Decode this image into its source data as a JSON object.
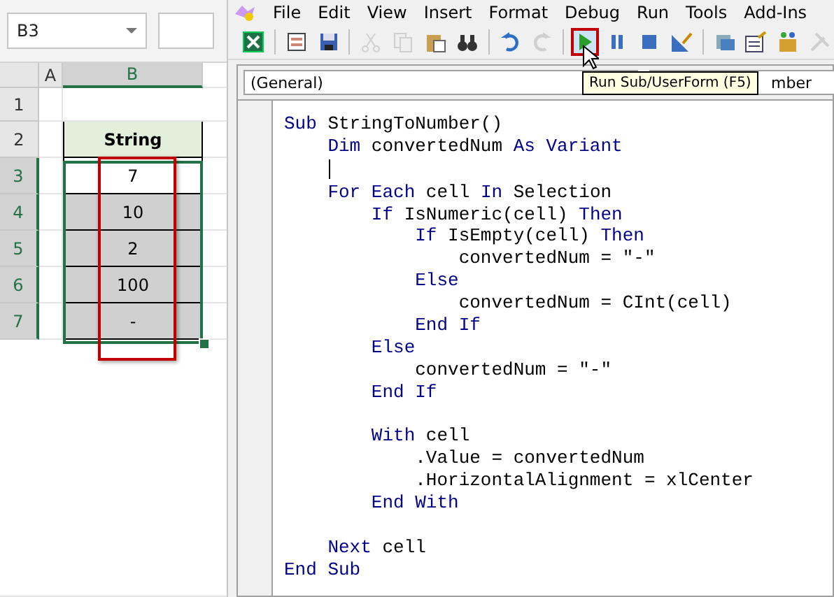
{
  "excel": {
    "name_box": "B3",
    "columns": [
      {
        "label": "A",
        "selected": false
      },
      {
        "label": "B",
        "selected": true
      }
    ],
    "rows": [
      {
        "number": "1",
        "kind": "empty",
        "selected": false
      },
      {
        "number": "2",
        "value": "String",
        "kind": "header",
        "selected": false
      },
      {
        "number": "3",
        "value": "7",
        "kind": "value",
        "selected": true,
        "active": true
      },
      {
        "number": "4",
        "value": "10",
        "kind": "value",
        "selected": true,
        "active": false
      },
      {
        "number": "5",
        "value": "2",
        "kind": "value",
        "selected": true,
        "active": false
      },
      {
        "number": "6",
        "value": "100",
        "kind": "value",
        "selected": true,
        "active": false
      },
      {
        "number": "7",
        "value": "-",
        "kind": "value",
        "selected": true,
        "active": false
      }
    ]
  },
  "vbe": {
    "menu": [
      "File",
      "Edit",
      "View",
      "Insert",
      "Format",
      "Debug",
      "Run",
      "Tools",
      "Add-Ins"
    ],
    "toolbar": [
      {
        "kind": "excel",
        "disabled": false,
        "selected": false
      },
      {
        "kind": "sep"
      },
      {
        "kind": "insert",
        "disabled": false,
        "selected": false
      },
      {
        "kind": "save",
        "disabled": false,
        "selected": false
      },
      {
        "kind": "sep"
      },
      {
        "kind": "cut",
        "disabled": true,
        "selected": false
      },
      {
        "kind": "copy",
        "disabled": true,
        "selected": false
      },
      {
        "kind": "paste",
        "disabled": false,
        "selected": false
      },
      {
        "kind": "find",
        "disabled": false,
        "selected": false
      },
      {
        "kind": "sep"
      },
      {
        "kind": "undo",
        "disabled": false,
        "selected": false
      },
      {
        "kind": "redo",
        "disabled": true,
        "selected": false
      },
      {
        "kind": "sep"
      },
      {
        "kind": "run",
        "disabled": false,
        "selected": true
      },
      {
        "kind": "pause",
        "disabled": false,
        "selected": false
      },
      {
        "kind": "stop",
        "disabled": false,
        "selected": false
      },
      {
        "kind": "design",
        "disabled": false,
        "selected": false
      },
      {
        "kind": "sep"
      },
      {
        "kind": "project",
        "disabled": false,
        "selected": false
      },
      {
        "kind": "properties",
        "disabled": false,
        "selected": false
      },
      {
        "kind": "objects",
        "disabled": false,
        "selected": false
      },
      {
        "kind": "tools",
        "disabled": true,
        "selected": false
      }
    ],
    "object_box": "(General)",
    "procedure_box": "mber",
    "tooltip": "Run Sub/UserForm (F5)",
    "code": [
      {
        "kind": "code",
        "tokens": [
          {
            "text": "Sub",
            "kind": "keyword"
          },
          {
            "text": " StringToNumber()",
            "kind": "plain"
          }
        ]
      },
      {
        "kind": "code",
        "tokens": [
          {
            "text": "    Dim",
            "kind": "keyword"
          },
          {
            "text": " convertedNum ",
            "kind": "plain"
          },
          {
            "text": "As Variant",
            "kind": "keyword"
          }
        ]
      },
      {
        "kind": "cursor"
      },
      {
        "kind": "code",
        "tokens": [
          {
            "text": "    For Each",
            "kind": "keyword"
          },
          {
            "text": " cell ",
            "kind": "plain"
          },
          {
            "text": "In",
            "kind": "keyword"
          },
          {
            "text": " Selection",
            "kind": "plain"
          }
        ]
      },
      {
        "kind": "code",
        "tokens": [
          {
            "text": "        If",
            "kind": "keyword"
          },
          {
            "text": " IsNumeric(cell) ",
            "kind": "plain"
          },
          {
            "text": "Then",
            "kind": "keyword"
          }
        ]
      },
      {
        "kind": "code",
        "tokens": [
          {
            "text": "            If",
            "kind": "keyword"
          },
          {
            "text": " IsEmpty(cell) ",
            "kind": "plain"
          },
          {
            "text": "Then",
            "kind": "keyword"
          }
        ]
      },
      {
        "kind": "code",
        "tokens": [
          {
            "text": "                convertedNum = \"-\"",
            "kind": "plain"
          }
        ]
      },
      {
        "kind": "code",
        "tokens": [
          {
            "text": "            Else",
            "kind": "keyword"
          }
        ]
      },
      {
        "kind": "code",
        "tokens": [
          {
            "text": "                convertedNum = CInt(cell)",
            "kind": "plain"
          }
        ]
      },
      {
        "kind": "code",
        "tokens": [
          {
            "text": "            End If",
            "kind": "keyword"
          }
        ]
      },
      {
        "kind": "code",
        "tokens": [
          {
            "text": "        Else",
            "kind": "keyword"
          }
        ]
      },
      {
        "kind": "code",
        "tokens": [
          {
            "text": "            convertedNum = \"-\"",
            "kind": "plain"
          }
        ]
      },
      {
        "kind": "code",
        "tokens": [
          {
            "text": "        End If",
            "kind": "keyword"
          }
        ]
      },
      {
        "kind": "blank"
      },
      {
        "kind": "code",
        "tokens": [
          {
            "text": "        With",
            "kind": "keyword"
          },
          {
            "text": " cell",
            "kind": "plain"
          }
        ]
      },
      {
        "kind": "code",
        "tokens": [
          {
            "text": "            .Value = convertedNum",
            "kind": "plain"
          }
        ]
      },
      {
        "kind": "code",
        "tokens": [
          {
            "text": "            .HorizontalAlignment = xlCenter",
            "kind": "plain"
          }
        ]
      },
      {
        "kind": "code",
        "tokens": [
          {
            "text": "        End With",
            "kind": "keyword"
          }
        ]
      },
      {
        "kind": "blank"
      },
      {
        "kind": "code",
        "tokens": [
          {
            "text": "    Next",
            "kind": "keyword"
          },
          {
            "text": " cell",
            "kind": "plain"
          }
        ]
      },
      {
        "kind": "code",
        "tokens": [
          {
            "text": "End Sub",
            "kind": "keyword"
          }
        ]
      }
    ]
  }
}
